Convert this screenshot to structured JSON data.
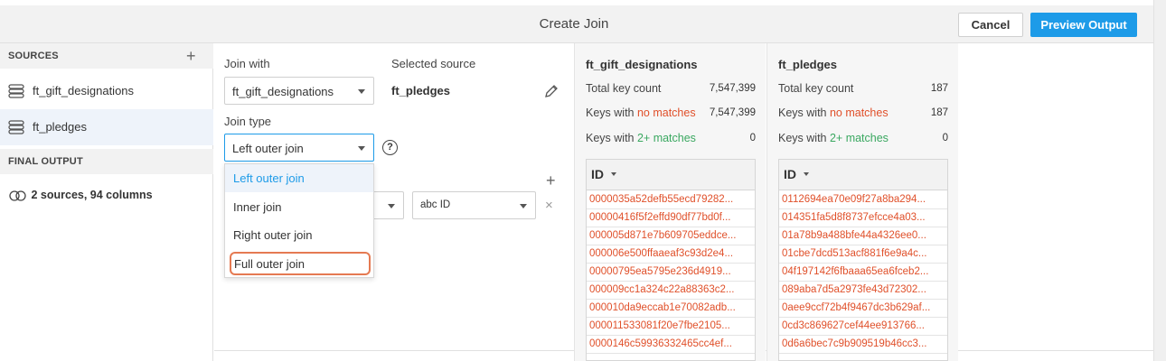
{
  "header": {
    "title": "Create Join",
    "cancel_label": "Cancel",
    "preview_label": "Preview Output"
  },
  "sidebar": {
    "sources_label": "SOURCES",
    "sources": [
      {
        "label": "ft_gift_designations",
        "selected": false
      },
      {
        "label": "ft_pledges",
        "selected": true
      }
    ],
    "final_output_label": "FINAL OUTPUT",
    "final_output_summary": "2 sources, 94 columns"
  },
  "config": {
    "join_with_label": "Join with",
    "join_with_value": "ft_gift_designations",
    "selected_source_label": "Selected source",
    "selected_source_value": "ft_pledges",
    "join_type_label": "Join type",
    "join_type_value": "Left outer join",
    "help_glyph": "?",
    "condition_right_value": "abc ID",
    "join_type_options": [
      "Left outer join",
      "Inner join",
      "Right outer join",
      "Full outer join"
    ]
  },
  "panels": [
    {
      "title": "ft_gift_designations",
      "total_key_label": "Total key count",
      "total_key_value": "7,547,399",
      "no_match_prefix": "Keys with ",
      "no_match_highlight": "no matches",
      "no_match_value": "7,547,399",
      "multi_match_prefix": "Keys with ",
      "multi_match_highlight": "2+ matches",
      "multi_match_value": "0",
      "column_header": "ID",
      "rows": [
        "0000035a52defb55ecd79282...",
        "00000416f5f2effd90df77bd0f...",
        "000005d871e7b609705eddce...",
        "000006e500ffaaeaf3c93d2e4...",
        "00000795ea5795e236d4919...",
        "000009cc1a324c22a88363c2...",
        "000010da9eccab1e70082adb...",
        "000011533081f20e7fbe2105...",
        "0000146c59936332465cc4ef..."
      ]
    },
    {
      "title": "ft_pledges",
      "total_key_label": "Total key count",
      "total_key_value": "187",
      "no_match_prefix": "Keys with ",
      "no_match_highlight": "no matches",
      "no_match_value": "187",
      "multi_match_prefix": "Keys with ",
      "multi_match_highlight": "2+ matches",
      "multi_match_value": "0",
      "column_header": "ID",
      "rows": [
        "0112694ea70e09f27a8ba294...",
        "014351fa5d8f8737efcce4a03...",
        "01a78b9a488bfe44a4326ee0...",
        "01cbe7dcd513acf881f6e9a4c...",
        "04f197142f6fbaaa65ea6fceb2...",
        "089aba7d5a2973fe43d72302...",
        "0aee9ccf72b4f9467dc3b629af...",
        "0cd3c869627cef44ee913766...",
        "0d6a6bec7c9b909519b46cc3..."
      ]
    }
  ],
  "colors": {
    "accent": "#1d9be8",
    "no_match": "#e0502a",
    "multi_match": "#3aa860",
    "highlight_ring": "#e57a52"
  },
  "icons": [
    "plus-icon",
    "database-icon",
    "venn-icon",
    "chevron-down-icon",
    "help-icon",
    "pencil-icon",
    "close-icon",
    "sort-caret-icon"
  ]
}
